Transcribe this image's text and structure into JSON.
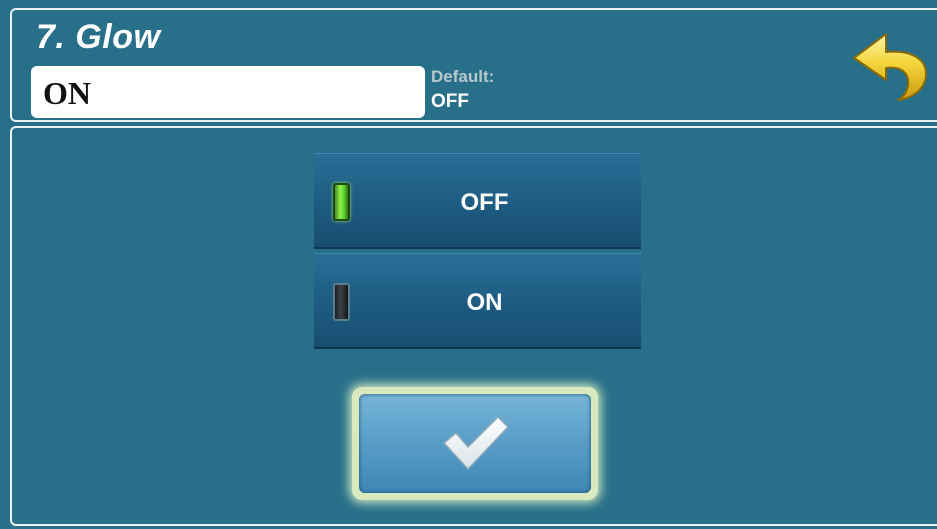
{
  "header": {
    "title": "7. Glow",
    "current_value": "ON",
    "default_label": "Default:",
    "default_value": "OFF",
    "back_icon": "return-arrow-icon"
  },
  "options": [
    {
      "label": "OFF",
      "indicator": "lit",
      "indicator_color": "#6fe03a"
    },
    {
      "label": "ON",
      "indicator": "unlit",
      "indicator_color": "#2a3034"
    }
  ],
  "confirm": {
    "icon": "checkmark-icon"
  },
  "colors": {
    "background": "#28708a",
    "option_button": "#1f5e85",
    "confirm_button": "#5b9fc8",
    "back_arrow": "#f2d23c"
  }
}
